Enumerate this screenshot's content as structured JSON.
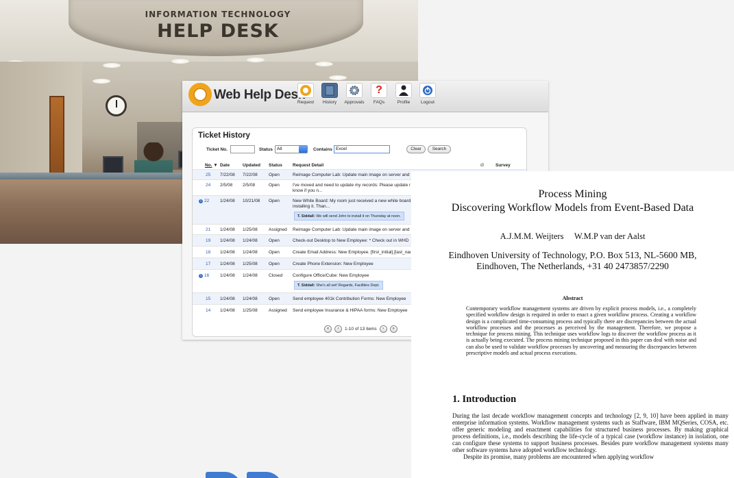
{
  "photo": {
    "sign_line1": "INFORMATION TECHNOLOGY",
    "sign_line2": "HELP DESK"
  },
  "web_help_desk": {
    "brand": "Web Help Desk",
    "brand_mark": "™",
    "nav": [
      {
        "label": "Request",
        "icon": "lifebuoy-icon",
        "color": "#f0a41b"
      },
      {
        "label": "History",
        "icon": "history-book-icon",
        "color": "#4d6f96"
      },
      {
        "label": "Approvals",
        "icon": "gear-icon",
        "color": "#6a7f96"
      },
      {
        "label": "FAQs",
        "icon": "question-icon",
        "color": "#d0241c"
      },
      {
        "label": "Profile",
        "icon": "person-icon",
        "color": "#333333"
      },
      {
        "label": "Logout",
        "icon": "power-icon",
        "color": "#2f6cc7"
      }
    ],
    "ticket_history": {
      "title": "Ticket History",
      "ticket_no_label": "Ticket No.",
      "ticket_no_value": "",
      "status_label": "Status",
      "status_value": "All",
      "contains_label": "Contains",
      "contains_value": "Excel",
      "clear_label": "Clear",
      "search_label": "Search",
      "columns": {
        "no": "No.",
        "sort_marker": "▼",
        "date": "Date",
        "updated": "Updated",
        "status": "Status",
        "detail": "Request Detail",
        "attachment": "Ø",
        "survey": "Survey"
      },
      "rows": [
        {
          "no": "25",
          "info": false,
          "date": "7/22/08",
          "updated": "7/22/08",
          "status": "Open",
          "detail": "Reimage Computer Lab: Update main image on server and"
        },
        {
          "no": "24",
          "info": false,
          "date": "2/5/08",
          "updated": "2/5/08",
          "status": "Open",
          "detail": "I've moved and need to update my records: Please update n",
          "detail2": "know if you n..."
        },
        {
          "no": "22",
          "info": true,
          "date": "1/24/08",
          "updated": "10/21/08",
          "status": "Open",
          "detail": "New White Board: My room just received a new white board",
          "detail2": "installing it. Than...",
          "note_author": "T. Siddall:",
          "note_text": "We will send John to install it on Thursday at noon."
        },
        {
          "no": "21",
          "info": false,
          "date": "1/24/08",
          "updated": "1/25/08",
          "status": "Assigned",
          "detail": "Reimage Computer Lab: Update main image on server and"
        },
        {
          "no": "19",
          "info": false,
          "date": "1/24/08",
          "updated": "1/24/08",
          "status": "Open",
          "detail": "Check-out Desktop to New Employee: * Check out in WHD"
        },
        {
          "no": "18",
          "info": false,
          "date": "1/24/08",
          "updated": "1/24/08",
          "status": "Open",
          "detail": "Create Email Address: New Employee. [first_initial].[last_nar"
        },
        {
          "no": "17",
          "info": false,
          "date": "1/24/08",
          "updated": "1/25/08",
          "status": "Open",
          "detail": "Create Phone Extension: New Employee"
        },
        {
          "no": "16",
          "info": true,
          "date": "1/24/08",
          "updated": "1/24/08",
          "status": "Closed",
          "detail": "Configure Office/Cube: New Employee",
          "note_author": "T. Siddall:",
          "note_text": "She's all set! Regards, Facilities Dept."
        },
        {
          "no": "15",
          "info": false,
          "date": "1/24/08",
          "updated": "1/24/08",
          "status": "Open",
          "detail": "Send employee 401k Contribution Forms: New Employee"
        },
        {
          "no": "14",
          "info": false,
          "date": "1/24/08",
          "updated": "1/25/08",
          "status": "Assigned",
          "detail": "Send employee Insurance & HIPAA forms: New Employee"
        }
      ],
      "pager_text": "1-10 of 13 items"
    }
  },
  "paper": {
    "title_line1": "Process Mining",
    "title_line2": "Discovering Workflow Models from Event-Based Data",
    "authors": "A.J.M.M. Weijters     W.M.P van der Aalst",
    "affiliation_line1": "Eindhoven University of Technology, P.O. Box 513, NL-5600 MB,",
    "affiliation_line2": "Eindhoven, The Netherlands, +31 40 2473857/2290",
    "abstract_heading": "Abstract",
    "abstract_text": "Contemporary workflow management systems are driven by explicit process models, i.e., a completely specified workflow design is required in order to enact a given workflow process. Creating a workflow design is a complicated time-consuming process and typically there are discrepancies between the actual workflow processes and the processes as perceived by the management. Therefore, we propose a technique for process mining. This technique uses workflow logs to discover the workflow process as it is actually being executed. The process mining technique proposed in this paper can deal with noise and can also be used to validate workflow processes by uncovering and measuring the discrepancies between prescriptive models and actual process executions.",
    "section_heading": "1. Introduction",
    "section_text": "During the last decade workflow management concepts and technology [2, 9, 10] have been applied in many enterprise information systems. Workflow management systems such as Staffware, IBM MQSeries, COSA, etc. offer generic modeling and enactment capabilities for structured business processes. By making graphical process definitions, i.e., models describing the life-cycle of a typical case (workflow instance) in isolation, one can configure these systems to support business processes. Besides pure workflow management systems many other software systems have adopted workflow technology.",
    "section_text_2": "Despite its promise, many problems are encountered when applying workflow"
  }
}
